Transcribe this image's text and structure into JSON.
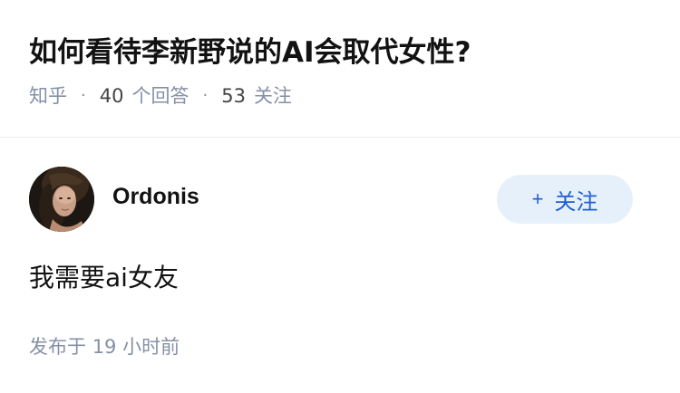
{
  "question": {
    "title": "如何看待李新野说的AI会取代女性?",
    "source": "知乎",
    "answer_count": "40",
    "answer_label": "个回答",
    "follower_count": "53",
    "follower_label": "关注"
  },
  "answer": {
    "author_name": "Ordonis",
    "follow_label": "关注",
    "content": "我需要ai女友",
    "published_prefix": "发布于",
    "published_time": "19 小时前"
  },
  "icons": {
    "follow": "plus-icon",
    "separator": "dot-separator"
  },
  "colors": {
    "accent": "#1f5fd1",
    "follow_bg": "#e6f0fb",
    "meta_gray": "#8590a6",
    "divider": "#ebebeb"
  }
}
